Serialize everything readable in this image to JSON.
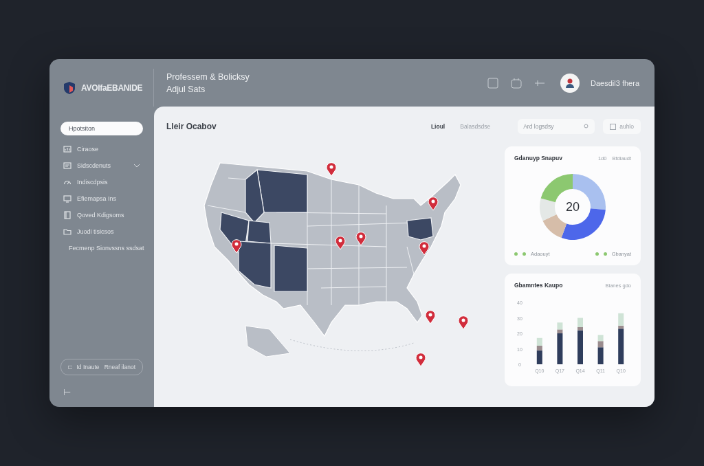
{
  "header": {
    "brand": "AVOIfaEBANIDE",
    "title_lines": [
      "Professem & Bolicksy",
      "Adjul Sats"
    ],
    "user_name": "Daesdil3 fhera"
  },
  "sidebar": {
    "items": [
      {
        "label": "Hpotsiton",
        "selected": true,
        "expandable": false
      },
      {
        "label": "Ciraose",
        "selected": false,
        "expandable": false
      },
      {
        "label": "Sidscdenuts",
        "selected": false,
        "expandable": true
      },
      {
        "label": "Indiscdpsis",
        "selected": false,
        "expandable": false
      },
      {
        "label": "Efiemapsa Ins",
        "selected": false,
        "expandable": false
      },
      {
        "label": "Qoved Kdigsoms",
        "selected": false,
        "expandable": false
      },
      {
        "label": "Juodi tisicsos",
        "selected": false,
        "expandable": false
      },
      {
        "label": "Fecmenp Sionvssns ssdsat",
        "selected": false,
        "expandable": false
      }
    ],
    "footer_button": {
      "label": "Id Inaute",
      "secondary": "Rneaf ilanot"
    },
    "collapse_glyph": "⊢"
  },
  "map_panel": {
    "title": "Lleir Ocabov",
    "tabs": [
      {
        "label": "Lioul",
        "selected": true
      },
      {
        "label": "Balasdsdse",
        "selected": false
      }
    ],
    "search": {
      "placeholder": "Ard logsdsy"
    },
    "filter_button": {
      "label": "auhlo"
    }
  },
  "donut_card": {
    "title": "Gdanuyp Snapuv",
    "meta": [
      "1d0",
      "Bfdiaudt"
    ],
    "center_value": "20",
    "legend": [
      {
        "label": "Adaouyt",
        "color": "#8cc870"
      },
      {
        "label": "Gbanyat",
        "color": "#8cc870"
      }
    ]
  },
  "bar_card": {
    "title": "Gbamntes Kaupo",
    "meta": "Bianes gdo",
    "chart_data": {
      "type": "bar",
      "stacked": true,
      "categories": [
        "Q10",
        "Q17",
        "Q14",
        "Q11",
        "Q10"
      ],
      "yticks": [
        0,
        10,
        20,
        30,
        40
      ],
      "ylim": [
        0,
        40
      ],
      "series": [
        {
          "color": "#2f3d5c",
          "values": [
            9,
            20,
            22,
            11,
            23
          ]
        },
        {
          "color": "#9a8c8e",
          "values": [
            3,
            2.5,
            2,
            4,
            2
          ]
        },
        {
          "color": "#cfe3d6",
          "values": [
            5,
            4.5,
            6,
            4,
            8
          ]
        }
      ]
    }
  }
}
